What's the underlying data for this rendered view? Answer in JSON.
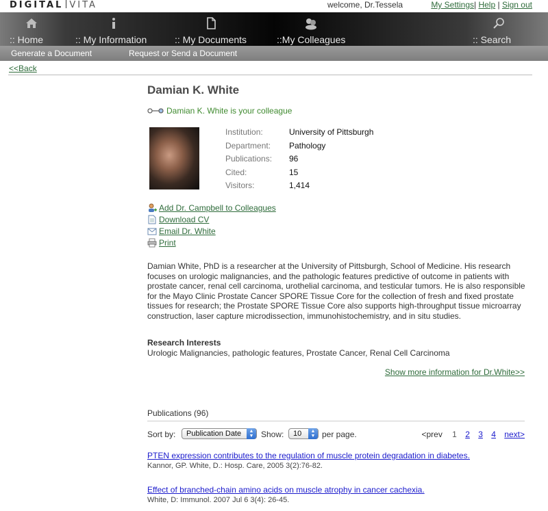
{
  "header": {
    "logo_left": "DIGITAL",
    "logo_right": "VITA",
    "welcome": "welcome, Dr.Tessela",
    "links": [
      "My Settings",
      "Help",
      "Sign out"
    ]
  },
  "nav": {
    "items": [
      {
        "label": ":: Home",
        "icon": "home-icon"
      },
      {
        "label": ":: My Information",
        "icon": "info-icon"
      },
      {
        "label": ":: My Documents",
        "icon": "document-icon"
      },
      {
        "label": "::My Colleagues",
        "icon": "colleagues-icon"
      },
      {
        "label": ":: Search",
        "icon": "search-icon"
      }
    ],
    "sub": [
      "Generate a Document",
      "Request or Send a Document"
    ]
  },
  "back_label": "<<Back",
  "profile": {
    "name": "Damian K. White",
    "colleague_status": "Damian K. White is your colleague",
    "fields": [
      {
        "key": "Institution:",
        "value": "University of Pittsburgh"
      },
      {
        "key": "Department:",
        "value": "Pathology"
      },
      {
        "key": "Publications:",
        "value": "96"
      },
      {
        "key": "Cited:",
        "value": "15"
      },
      {
        "key": "Visitors:",
        "value": "1,414"
      }
    ]
  },
  "actions": [
    {
      "label": "Add Dr. Campbell to Colleagues",
      "icon": "add-colleague-icon"
    },
    {
      "label": "Download CV",
      "icon": "cv-document-icon"
    },
    {
      "label": "Email Dr. White",
      "icon": "email-icon"
    },
    {
      "label": "Print",
      "icon": "printer-icon"
    }
  ],
  "bio": "Damian White, PhD is a researcher at the University of Pittsburgh, School of Medicine. His research focuses on urologic malignancies, and the pathologic features predictive of outcome in patients with prostate cancer, renal cell carcinoma, urothelial carcinoma, and testicular tumors. He is also responsible for the Mayo Clinic Prostate Cancer SPORE Tissue Core for the collection of fresh and fixed prostate tissues for research; the Prostate SPORE Tissue Core also supports high-throughput tissue microarray construction, laser capture microdissection, immunohistochemistry, and in situ studies.",
  "research": {
    "heading": "Research Interests",
    "text": "Urologic Malignancies, pathologic features, Prostate Cancer, Renal Cell Carcinoma"
  },
  "show_more": "Show more information for Dr.White>>",
  "publications": {
    "heading": "Publications (96)",
    "sort_label": "Sort by:",
    "sort_value": "Publication Date",
    "show_label": "Show:",
    "show_value": "10",
    "per_page": "per page.",
    "pager": {
      "prev": "<prev",
      "current": "1",
      "pages": [
        "2",
        "3",
        "4"
      ],
      "next": "next>"
    },
    "items": [
      {
        "title": "PTEN expression contributes to the regulation of muscle protein degradation in diabetes.",
        "citation": "Kannor, GP. White, D.: Hosp. Care, 2005 3(2):76-82."
      },
      {
        "title": "Effect of branched-chain amino acids on muscle atrophy in cancer cachexia.",
        "citation": "White, D: Immunol. 2007 Jul 6 3(4): 26-45."
      }
    ]
  }
}
